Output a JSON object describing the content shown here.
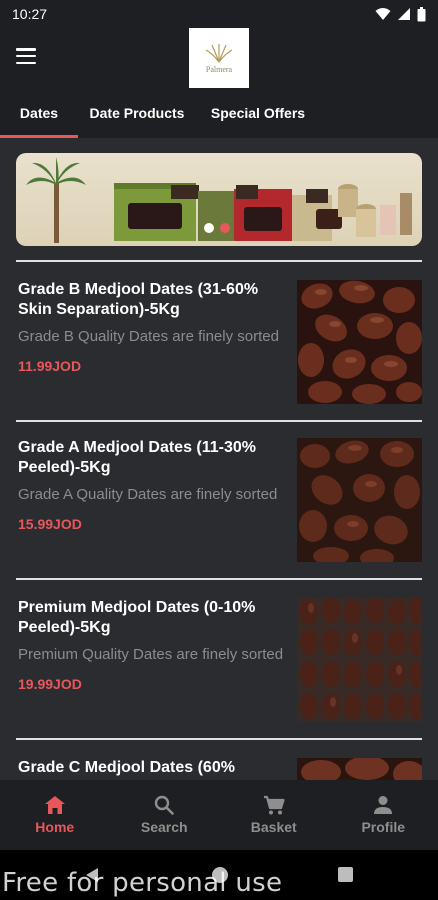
{
  "status_bar": {
    "time": "10:27"
  },
  "header": {
    "logo_text": "Palmera",
    "logo_brand": "Palmera"
  },
  "tabs": [
    {
      "label": "Dates",
      "active": true
    },
    {
      "label": "Date Products",
      "active": false
    },
    {
      "label": "Special Offers",
      "active": false
    }
  ],
  "banner": {
    "carousel_pages": 2,
    "current_page": 2
  },
  "products": [
    {
      "title": "Grade B Medjool Dates (31-60% Skin Separation)-5Kg",
      "description": "Grade B Quality Dates are finely sorted",
      "price": "11.99JOD"
    },
    {
      "title": "Grade A Medjool Dates (11-30% Peeled)-5Kg",
      "description": "Grade A Quality Dates are finely sorted",
      "price": "15.99JOD"
    },
    {
      "title": "Premium Medjool Dates (0-10% Peeled)-5Kg",
      "description": "Premium Quality Dates are finely sorted",
      "price": "19.99JOD"
    },
    {
      "title": "Grade C Medjool Dates (60%",
      "description": "",
      "price": ""
    }
  ],
  "bottom_nav": [
    {
      "label": "Home",
      "icon": "home-icon",
      "active": true
    },
    {
      "label": "Search",
      "icon": "search-icon",
      "active": false
    },
    {
      "label": "Basket",
      "icon": "cart-icon",
      "active": false
    },
    {
      "label": "Profile",
      "icon": "person-icon",
      "active": false
    }
  ],
  "watermark": "Free for personal use",
  "colors": {
    "accent": "#e8575a",
    "background": "#2b2c30",
    "bar": "#1e1f22",
    "muted": "#8c8c8c"
  }
}
